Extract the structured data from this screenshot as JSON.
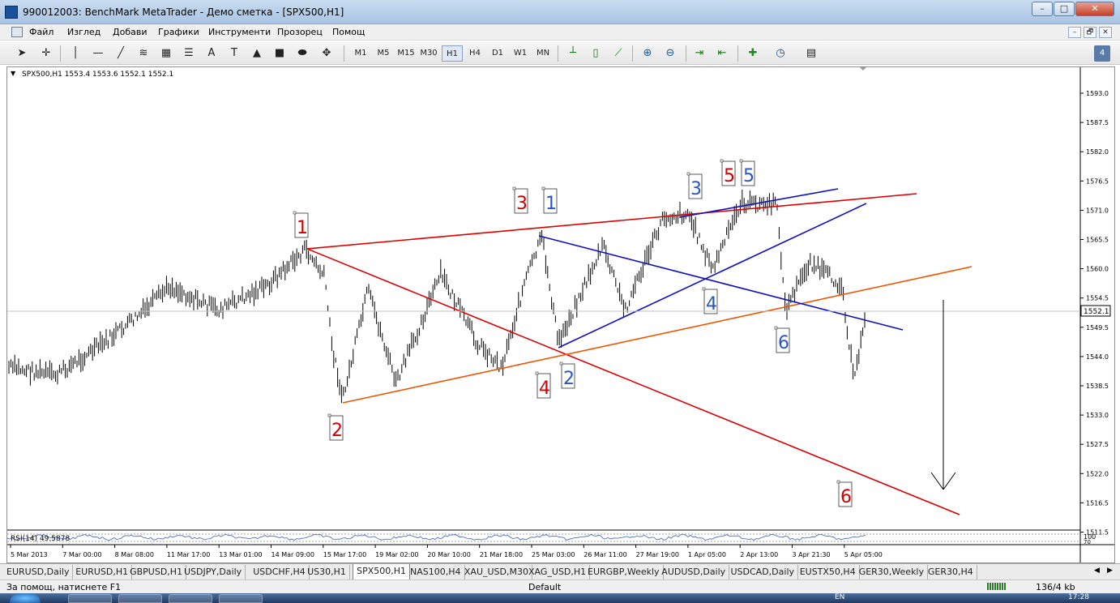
{
  "window": {
    "title": "990012003: BenchMark MetaTrader - Демо сметка - [SPX500,H1]",
    "minimize": "–",
    "maximize": "□",
    "close": "✕"
  },
  "menu": {
    "items": [
      "Файл",
      "Изглед",
      "Добави",
      "Графики",
      "Инструменти",
      "Прозорец",
      "Помощ"
    ],
    "mdi": [
      "–",
      "🗗",
      "✕"
    ]
  },
  "toolbar": {
    "timeframes": [
      "M1",
      "M5",
      "M15",
      "M30",
      "H1",
      "H4",
      "D1",
      "W1",
      "MN"
    ],
    "active_timeframe": "H1",
    "badge": "4"
  },
  "chart": {
    "header": "SPX500,H1  1553.4 1553.6 1552.1 1552.1",
    "current_price": "1552.1",
    "rsi_label": "RSI(14) 49.5878",
    "rsi_levels": [
      "100",
      "70",
      "30"
    ],
    "price_ticks": [
      "1593.0",
      "1587.5",
      "1582.0",
      "1576.5",
      "1571.0",
      "1565.5",
      "1560.0",
      "1554.5",
      "1549.5",
      "1544.0",
      "1538.5",
      "1533.0",
      "1527.5",
      "1522.0",
      "1516.5",
      "1511.5"
    ],
    "time_ticks": [
      "5 Mar 2013",
      "7 Mar 00:00",
      "8 Mar 08:00",
      "11 Mar 17:00",
      "13 Mar 01:00",
      "14 Mar 09:00",
      "15 Mar 17:00",
      "19 Mar 02:00",
      "20 Mar 10:00",
      "21 Mar 18:00",
      "25 Mar 03:00",
      "26 Mar 11:00",
      "27 Mar 19:00",
      "1 Apr 05:00",
      "2 Apr 13:00",
      "3 Apr 21:30",
      "5 Apr 05:00"
    ],
    "labels": [
      {
        "text": "1",
        "color": "red"
      },
      {
        "text": "2",
        "color": "red"
      },
      {
        "text": "3",
        "color": "red"
      },
      {
        "text": "4",
        "color": "red"
      },
      {
        "text": "5",
        "color": "red"
      },
      {
        "text": "6",
        "color": "red"
      },
      {
        "text": "1",
        "color": "blue"
      },
      {
        "text": "2",
        "color": "blue"
      },
      {
        "text": "3",
        "color": "blue"
      },
      {
        "text": "4",
        "color": "blue"
      },
      {
        "text": "5",
        "color": "blue"
      },
      {
        "text": "6",
        "color": "blue"
      }
    ]
  },
  "tabs": [
    "EURUSD,Daily",
    "EURUSD,H1",
    "GBPUSD,H1",
    "USDJPY,Daily",
    "USDCHF,H4",
    "US30,H1",
    "SPX500,H1",
    "NAS100,H4",
    "XAU_USD,M30",
    "XAG_USD,H1",
    "EURGBP,Weekly",
    "AUDUSD,Daily",
    "USDCAD,Daily",
    "EUSTX50,H4",
    "GER30,Weekly",
    "GER30,H4"
  ],
  "active_tab": "SPX500,H1",
  "status": {
    "help": "За помощ, натиснете F1",
    "profile": "Default",
    "traffic": "136/4 kb"
  },
  "taskbar": {
    "clock": "17:28",
    "lang": "EN"
  },
  "colors": {
    "red_line": "#dd0000",
    "blue_line": "#1010c0",
    "orange_line": "#ee5500",
    "label_red": "#d00000",
    "label_blue": "#2a55c0"
  }
}
